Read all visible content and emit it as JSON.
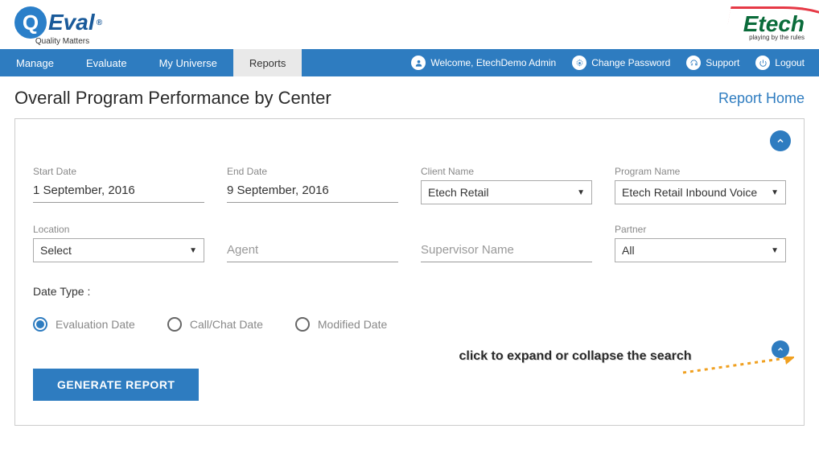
{
  "logo": {
    "left_main": "Eval",
    "left_q": "Q",
    "left_tag": "Quality Matters",
    "right_main": "Etech",
    "right_tag": "playing by the rules"
  },
  "nav": {
    "items": [
      "Manage",
      "Evaluate",
      "My Universe",
      "Reports"
    ],
    "active_index": 3,
    "welcome_prefix": "Welcome, ",
    "welcome_user": "EtechDemo Admin",
    "change_password": "Change Password",
    "support": "Support",
    "logout": "Logout"
  },
  "page": {
    "title": "Overall Program Performance by Center",
    "report_home": "Report Home"
  },
  "form": {
    "start_date": {
      "label": "Start Date",
      "value": "1 September, 2016"
    },
    "end_date": {
      "label": "End Date",
      "value": "9 September, 2016"
    },
    "client_name": {
      "label": "Client Name",
      "value": "Etech Retail"
    },
    "program_name": {
      "label": "Program Name",
      "value": "Etech Retail Inbound Voice"
    },
    "location": {
      "label": "Location",
      "value": "Select"
    },
    "agent": {
      "placeholder": "Agent"
    },
    "supervisor": {
      "placeholder": "Supervisor Name"
    },
    "partner": {
      "label": "Partner",
      "value": "All"
    },
    "date_type_label": "Date Type :",
    "date_type_options": [
      "Evaluation Date",
      "Call/Chat Date",
      "Modified Date"
    ],
    "date_type_selected": 0,
    "generate_button": "GENERATE REPORT"
  },
  "annotation": {
    "text": "click to expand or collapse the search"
  }
}
